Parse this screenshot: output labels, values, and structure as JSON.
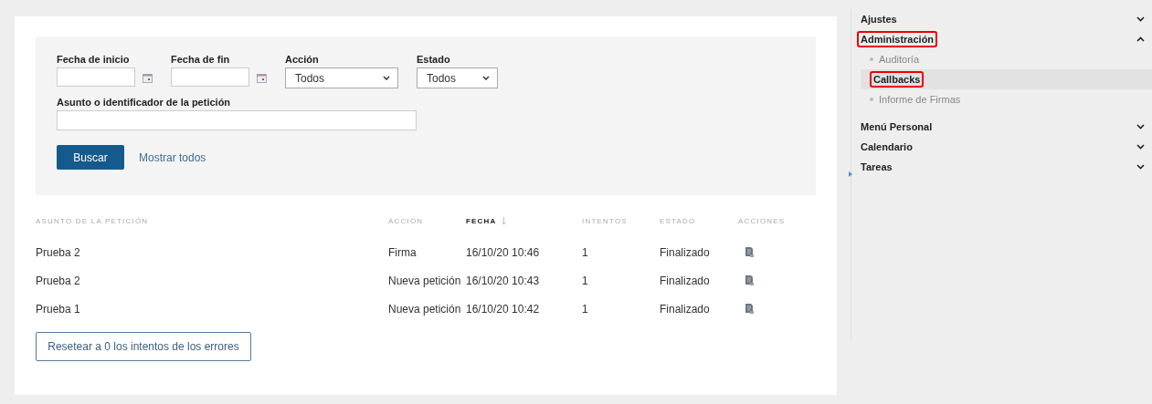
{
  "filters": {
    "start_date": {
      "label": "Fecha de inicio"
    },
    "end_date": {
      "label": "Fecha de fin"
    },
    "action": {
      "label": "Acción",
      "value": "Todos"
    },
    "status": {
      "label": "Estado",
      "value": "Todos"
    },
    "subject": {
      "label": "Asunto o identificador de la petición"
    },
    "search_button": "Buscar",
    "show_all_link": "Mostrar todos"
  },
  "table": {
    "columns": [
      {
        "label": "ASUNTO DE LA PETICIÓN",
        "sorted": false
      },
      {
        "label": "ACCIÓN",
        "sorted": false
      },
      {
        "label": "FECHA",
        "sorted": true
      },
      {
        "label": "INTENTOS",
        "sorted": false
      },
      {
        "label": "ESTADO",
        "sorted": false
      },
      {
        "label": "ACCIONES",
        "sorted": false
      }
    ],
    "rows": [
      {
        "subject": "Prueba 2",
        "action": "Firma",
        "date": "16/10/20 10:46",
        "attempts": "1",
        "status": "Finalizado"
      },
      {
        "subject": "Prueba 2",
        "action": "Nueva petición",
        "date": "16/10/20 10:43",
        "attempts": "1",
        "status": "Finalizado"
      },
      {
        "subject": "Prueba 1",
        "action": "Nueva petición",
        "date": "16/10/20 10:42",
        "attempts": "1",
        "status": "Finalizado"
      }
    ]
  },
  "reset_button": "Resetear a 0 los intentos de los errores",
  "sidebar": {
    "items": [
      {
        "label": "Ajustes",
        "expanded": false,
        "highlighted": false
      },
      {
        "label": "Administración",
        "expanded": true,
        "highlighted": true,
        "children": [
          {
            "label": "Auditoría",
            "selected": false,
            "highlighted": false
          },
          {
            "label": "Callbacks",
            "selected": true,
            "highlighted": true
          },
          {
            "label": "Informe de Firmas",
            "selected": false,
            "highlighted": false
          }
        ]
      },
      {
        "label": "Menú Personal",
        "expanded": false,
        "highlighted": false
      },
      {
        "label": "Calendario",
        "expanded": false,
        "highlighted": false
      },
      {
        "label": "Tareas",
        "expanded": false,
        "highlighted": false
      }
    ]
  }
}
